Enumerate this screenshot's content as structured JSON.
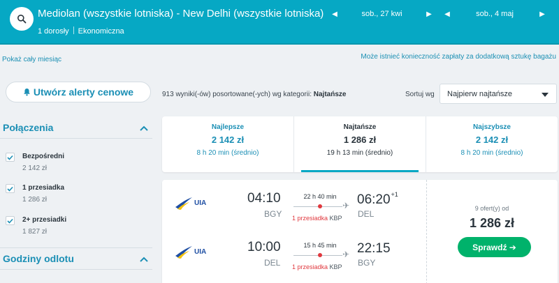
{
  "header": {
    "route": "Mediolan (wszystkie lotniska) - New Delhi (wszystkie lotniska)",
    "passengers": "1 dorosły",
    "cabin": "Ekonomiczna",
    "depart_date": "sob., 27 kwi",
    "return_date": "sob., 4 maj",
    "prev_arrow": "◀",
    "next_arrow": "▶"
  },
  "info": {
    "show_month": "Pokaż cały miesiąc",
    "baggage_notice": "Może istnieć konieczność zapłaty za dodatkową sztukę bagażu"
  },
  "sidebar": {
    "alert_button": "Utwórz alerty cenowe",
    "connections_title": "Połączenia",
    "filters": [
      {
        "label": "Bezpośredni",
        "price": "2 142 zł",
        "checked": true
      },
      {
        "label": "1 przesiadka",
        "price": "1 286 zł",
        "checked": true
      },
      {
        "label": "2+ przesiadki",
        "price": "1 827 zł",
        "checked": true
      }
    ],
    "departure_title": "Godziny odlotu"
  },
  "sort": {
    "results_text": "913 wyniki(-ów) posortowane(-ych) wg kategorii:",
    "results_category": "Najtańsze",
    "sort_label": "Sortuj wg",
    "sort_value": "Najpierw najtańsze"
  },
  "tabs": [
    {
      "name": "Najlepsze",
      "price": "2 142 zł",
      "time": "8 h 20 min (średnio)",
      "active": false
    },
    {
      "name": "Najtańsze",
      "price": "1 286 zł",
      "time": "19 h 13 min (średnio)",
      "active": true
    },
    {
      "name": "Najszybsze",
      "price": "2 142 zł",
      "time": "8 h 20 min (średnio)",
      "active": false
    }
  ],
  "result": {
    "airline": "UIA",
    "legs": [
      {
        "dep_time": "04:10",
        "dep_airport": "BGY",
        "duration": "22 h 40 min",
        "stops": "1 przesiadka",
        "via": "KBP",
        "arr_time": "06:20",
        "day_offset": "+1",
        "arr_airport": "DEL"
      },
      {
        "dep_time": "10:00",
        "dep_airport": "DEL",
        "duration": "15 h 45 min",
        "stops": "1 przesiadka",
        "via": "KBP",
        "arr_time": "22:15",
        "day_offset": "",
        "arr_airport": "BGY"
      }
    ],
    "offers": "9 ofert(y) od",
    "price": "1 286 zł",
    "check_button": "Sprawdź ➔"
  },
  "colors": {
    "header_bg": "#06a8c4",
    "link_blue": "#1b8fb5",
    "green_button": "#00b26b",
    "stop_red": "#e0383e"
  }
}
